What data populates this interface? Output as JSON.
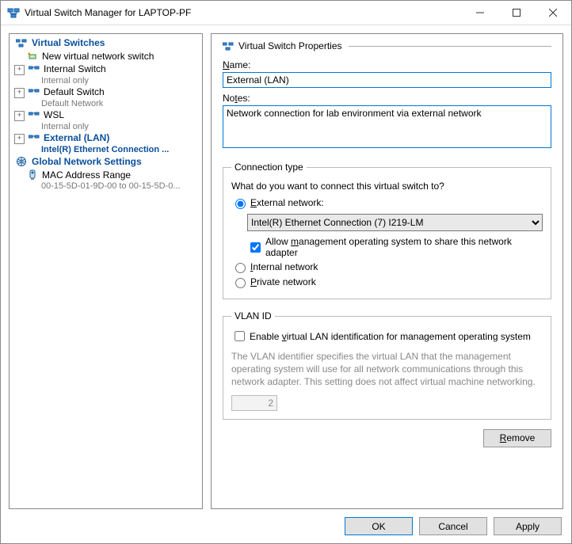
{
  "window": {
    "title": "Virtual Switch Manager for LAPTOP-PF"
  },
  "tree": {
    "header1": "Virtual Switches",
    "new_switch": "New virtual network switch",
    "items": [
      {
        "name": "Internal Switch",
        "sub": "Internal only"
      },
      {
        "name": "Default Switch",
        "sub": "Default Network"
      },
      {
        "name": "WSL",
        "sub": "Internal only"
      },
      {
        "name": "External (LAN)",
        "sub": "Intel(R) Ethernet Connection ..."
      }
    ],
    "header2": "Global Network Settings",
    "mac": {
      "name": "MAC Address Range",
      "sub": "00-15-5D-01-9D-00 to 00-15-5D-0..."
    }
  },
  "props": {
    "header": "Virtual Switch Properties",
    "name_label": "Name:",
    "name_value": "External (LAN)",
    "notes_label": "Notes:",
    "notes_value": "Network connection for lab environment via external network",
    "conn": {
      "legend": "Connection type",
      "question": "What do you want to connect this virtual switch to?",
      "external": "External network:",
      "adapter": "Intel(R) Ethernet Connection (7) I219-LM",
      "allow_mgmt": "Allow management operating system to share this network adapter",
      "internal": "Internal network",
      "private": "Private network"
    },
    "vlan": {
      "legend": "VLAN ID",
      "enable": "Enable virtual LAN identification for management operating system",
      "desc": "The VLAN identifier specifies the virtual LAN that the management operating system will use for all network communications through this network adapter. This setting does not affect virtual machine networking.",
      "value": "2"
    },
    "remove": "Remove"
  },
  "footer": {
    "ok": "OK",
    "cancel": "Cancel",
    "apply": "Apply"
  }
}
